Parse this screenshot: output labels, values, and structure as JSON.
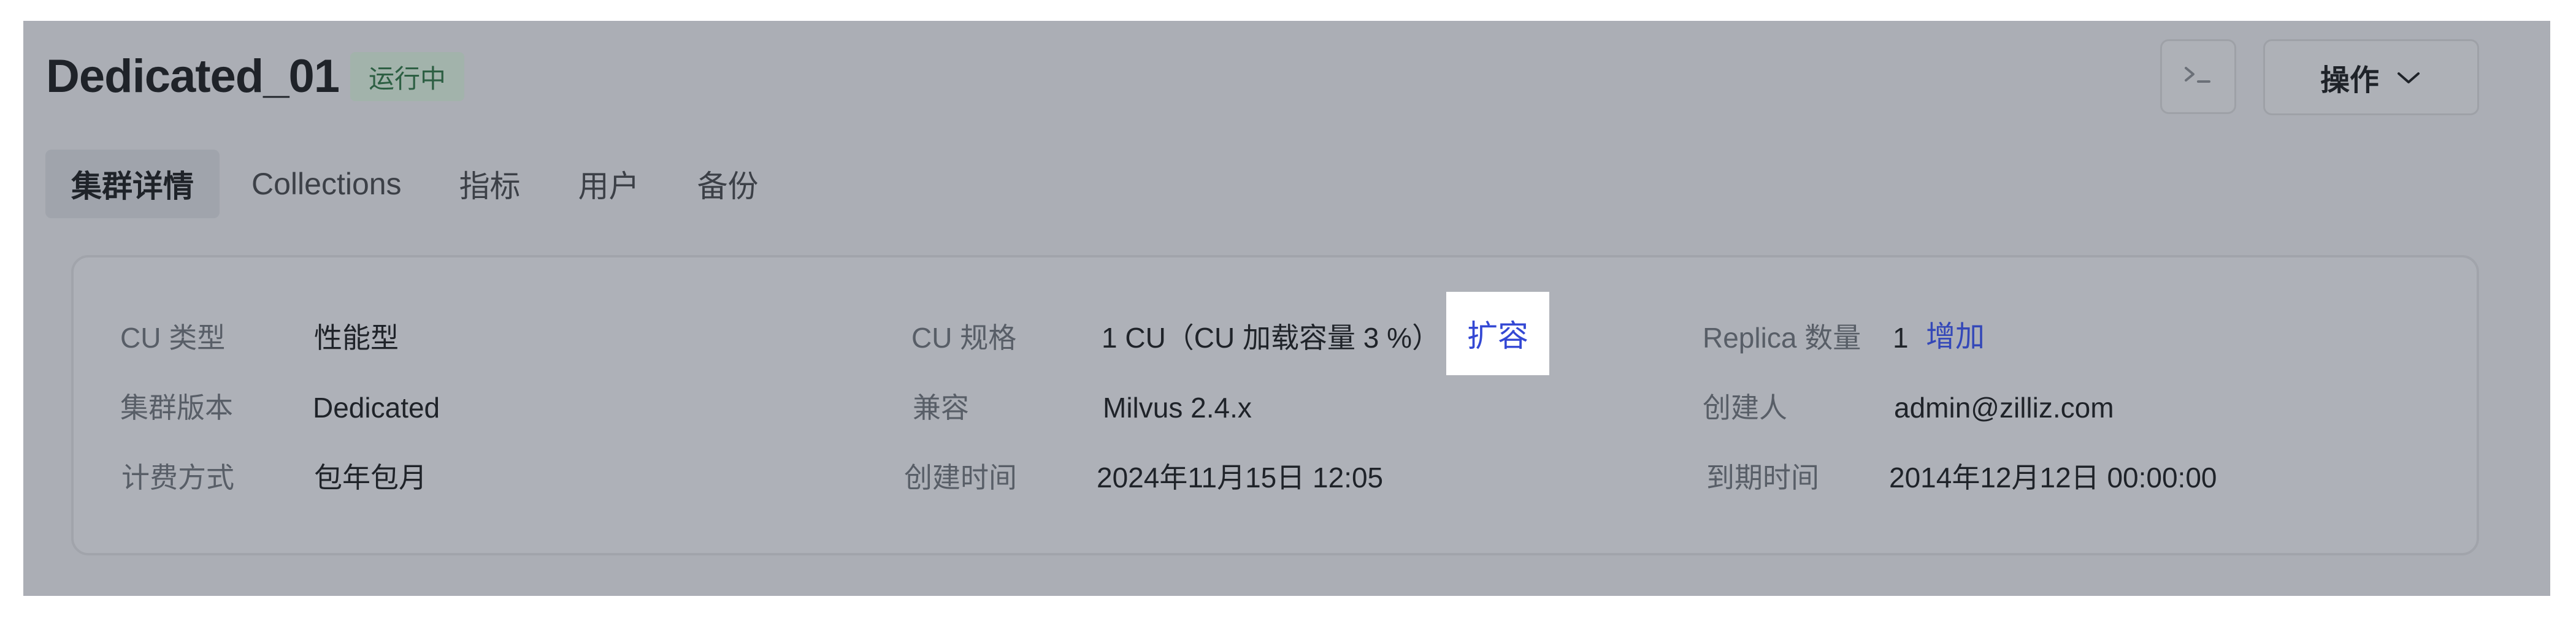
{
  "header": {
    "title": "Dedicated_01",
    "status": "运行中",
    "terminal_icon": "terminal-icon",
    "actions_label": "操作",
    "actions_icon": "chevron-down-icon"
  },
  "tabs": [
    {
      "label": "集群详情",
      "active": true
    },
    {
      "label": "Collections",
      "active": false
    },
    {
      "label": "指标",
      "active": false
    },
    {
      "label": "用户",
      "active": false
    },
    {
      "label": "备份",
      "active": false
    }
  ],
  "details": {
    "cu_type_label": "CU 类型",
    "cu_type_value": "性能型",
    "cluster_version_label": "集群版本",
    "cluster_version_value": "Dedicated",
    "billing_label": "计费方式",
    "billing_value": "包年包月",
    "cu_spec_label": "CU 规格",
    "cu_spec_value": "1 CU（CU 加载容量 3 %）",
    "expand_link": "扩容",
    "compat_label": "兼容",
    "compat_value": "Milvus 2.4.x",
    "created_time_label": "创建时间",
    "created_time_value": "2024年11月15日 12:05",
    "replica_label": "Replica 数量",
    "replica_value": "1",
    "add_link": "增加",
    "creator_label": "创建人",
    "creator_value": "admin@zilliz.com",
    "expire_label": "到期时间",
    "expire_value": "2014年12月12日 00:00:00"
  },
  "colors": {
    "overlay": "#abaeb5",
    "link": "#3448b8",
    "status_text": "#2d5f43"
  }
}
